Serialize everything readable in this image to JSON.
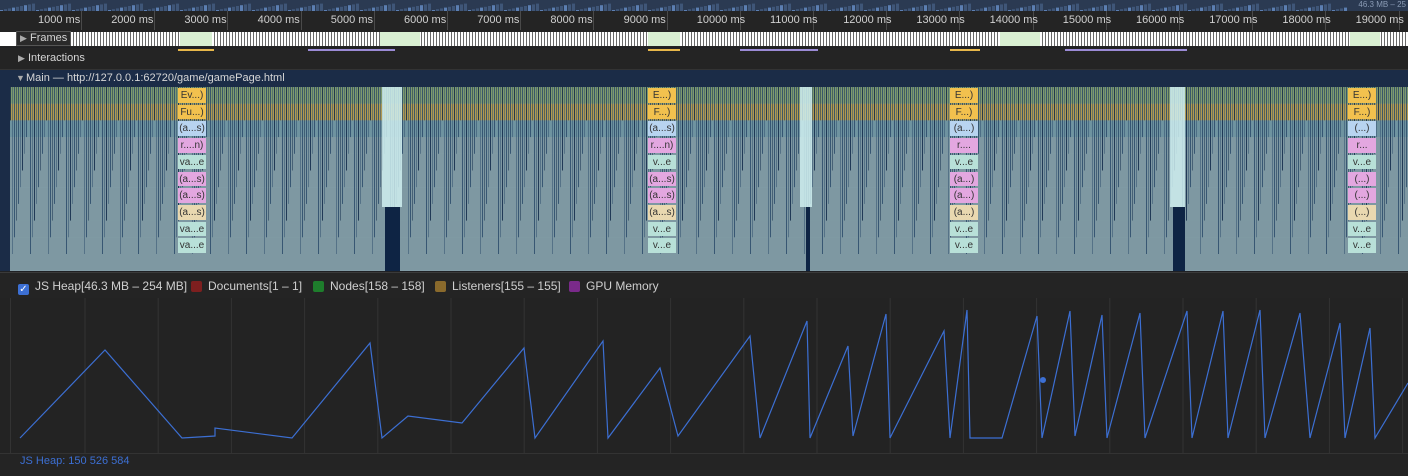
{
  "ruler": {
    "ticks": [
      "1000 ms",
      "2000 ms",
      "3000 ms",
      "4000 ms",
      "5000 ms",
      "6000 ms",
      "7000 ms",
      "8000 ms",
      "9000 ms",
      "10000 ms",
      "11000 ms",
      "12000 ms",
      "13000 ms",
      "14000 ms",
      "15000 ms",
      "16000 ms",
      "17000 ms",
      "18000 ms",
      "19000 ms"
    ]
  },
  "overview": {
    "range_label": "46.3 MB – 25"
  },
  "tracks": {
    "frames": "Frames",
    "interactions": "Interactions",
    "main": "Main — http://127.0.0.1:62720/game/gamePage.html"
  },
  "flame_columns": [
    {
      "labels": [
        "Ev...)",
        "Fu...)",
        "(a...s)",
        "r....n)",
        "va...e",
        "(a...s)",
        "(a...s)",
        "(a...s)",
        "va...e",
        "va...e"
      ]
    },
    {
      "labels": [
        "E...)",
        "F...)",
        "(a...s)",
        "r....n)",
        "v...e",
        "(a...s)",
        "(a...s)",
        "(a...s)",
        "v...e",
        "v...e"
      ]
    },
    {
      "labels": [
        "E...)",
        "F...)",
        "(a...)",
        "r....",
        "v...e",
        "(a...)",
        "(a...)",
        "(a...)",
        "v...e",
        "v...e"
      ]
    },
    {
      "labels": [
        "E...)",
        "F...)",
        "(...)",
        "r...",
        "v...e",
        "(...)",
        "(...)",
        "(...)",
        "v...e",
        "v...e"
      ]
    }
  ],
  "legend": {
    "js_heap": "JS Heap[46.3 MB – 254 MB]",
    "documents": "Documents[1 – 1]",
    "nodes": "Nodes[158 – 158]",
    "listeners": "Listeners[155 – 155]",
    "gpu": "GPU Memory"
  },
  "colors": {
    "js_heap": "#3c6fd3",
    "documents": "#7d1f1f",
    "nodes": "#1e7d2c",
    "listeners": "#8a6a2c",
    "gpu": "#7a2a8a"
  },
  "footer": {
    "value": "JS Heap: 150 526 584"
  }
}
